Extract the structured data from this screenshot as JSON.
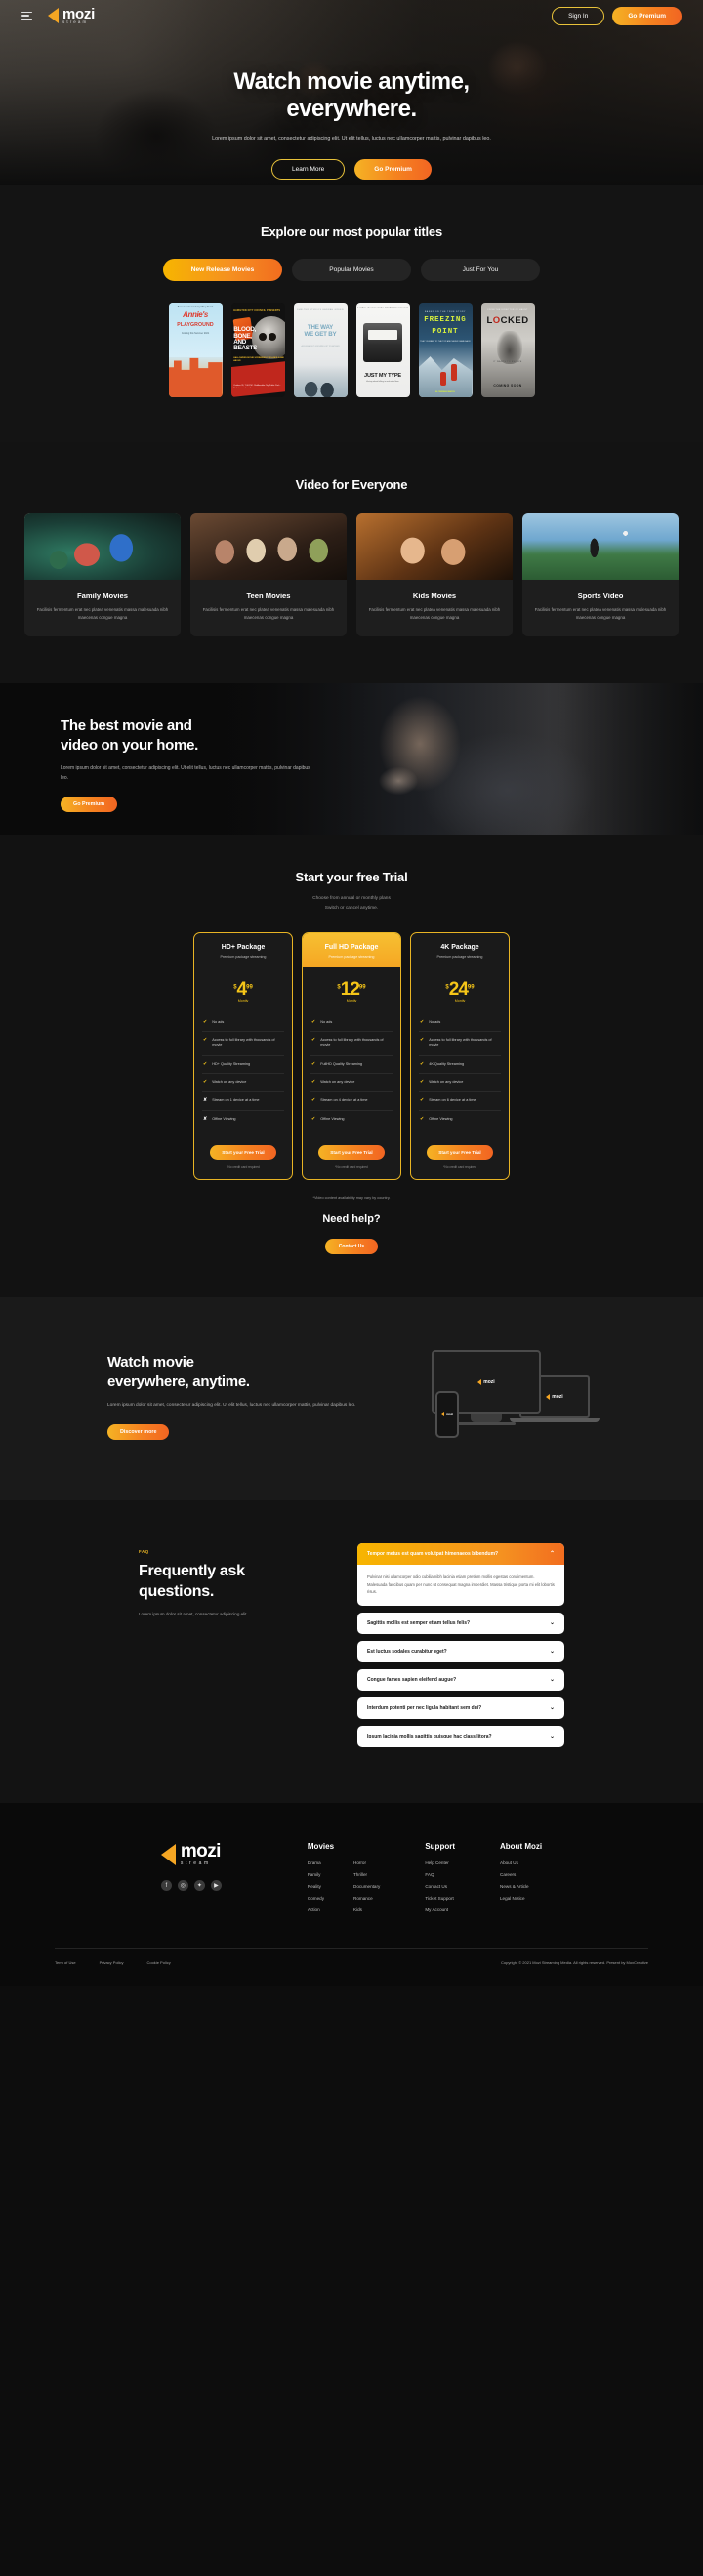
{
  "header": {
    "menu_icon": "hamburger-icon",
    "logo_word": "mozi",
    "logo_sub": "stream",
    "sign_in": "Sign In",
    "go_premium": "Go Premium"
  },
  "hero": {
    "title_line1": "Watch movie anytime,",
    "title_line2": "everywhere.",
    "desc": "Lorem ipsum dolor sit amet, consectetur adipiscing elit. Ut elit tellus, luctus nec ullamcorper mattis, pulvinar dapibus leo.",
    "learn_more": "Learn More",
    "go_premium": "Go Premium"
  },
  "explore": {
    "title": "Explore our most popular titles",
    "tabs": [
      {
        "label": "New Release Movies",
        "active": true
      },
      {
        "label": "Popular Movies",
        "active": false
      },
      {
        "label": "Just For You",
        "active": false
      }
    ],
    "posters": [
      {
        "title": "Annie's Playground",
        "line1": "Annie's",
        "line2": "PLAYGROUND",
        "credit": "Based on the book by Miley Stuart",
        "sub": "Coming this Summer 2021"
      },
      {
        "title": "Blood, Bone, and Beasts",
        "tag": "HAMILTON CITY COUNCIL PRESENTS",
        "line1": "BLOOD,",
        "line2": "BONE,",
        "line3": "AND",
        "line4": "BEASTS",
        "sub": "HALLOWEEN MOVIE SCREENING FOR AGES 6 AND ABOVE",
        "foot": "October 31, 7:30 PM  ·  Riddlesdale City Public Park  ·  Tickets on sale online"
      },
      {
        "title": "The Way We Get By",
        "credit": "SHELTER STUDIOS          HANNAH GREEN",
        "line1": "THE WAY",
        "line2": "WE GET BY",
        "sub": "A FILM ABOUT GROWING UP TOGETHER"
      },
      {
        "title": "Just My Type",
        "credit": "STUART MCGILLIVRAY            SARAH McCULLOCH",
        "line1": "JUST MY TYPE",
        "sub": "A story about falling in and out of love"
      },
      {
        "title": "Freezing Point",
        "credit": "BASED ON THE TRUE STORY",
        "line1": "FREEZING",
        "line2": "POINT",
        "sub": "THEY CLIMBED TO THE TOP AND NEVER CAME BACK",
        "foot": "IN CINEMAS MARCH"
      },
      {
        "title": "Locked",
        "top": "FROM THE DIRECTOR OF HAUNT",
        "line1": "LOCKED",
        "sub": "IT WANTS TO ESCAPE",
        "coming": "COMING SOON"
      }
    ]
  },
  "everyone": {
    "title": "Video for Everyone",
    "cards": [
      {
        "title": "Family Movies",
        "desc": "Facilisis fermentum erat nec platea venenatis massa malesuada nibh maecenas congue magna"
      },
      {
        "title": "Teen Movies",
        "desc": "Facilisis fermentum erat nec platea venenatis massa malesuada nibh maecenas congue magna"
      },
      {
        "title": "Kids Movies",
        "desc": "Facilisis fermentum erat nec platea venenatis massa malesuada nibh maecenas congue magna"
      },
      {
        "title": "Sports Video",
        "desc": "Facilisis fermentum erat nec platea venenatis massa malesuada nibh maecenas congue magna"
      }
    ]
  },
  "banner": {
    "title_line1": "The best movie and",
    "title_line2": "video on your home.",
    "desc": "Lorem ipsum dolor sit amet, consectetur adipiscing elit. Ut elit tellus, luctus nec ullamcorper mattis, pulvinar dapibus leo.",
    "cta": "Go Premium"
  },
  "pricing": {
    "title": "Start your free Trial",
    "sub_line1": "Choose from annual or monthly plans",
    "sub_line2": "Switch or cancel anytime.",
    "plans": [
      {
        "name": "HD+ Package",
        "tag": "Premium package streaming",
        "currency": "$",
        "price": "4",
        "decimals": "99",
        "period": "Montly",
        "featured": false,
        "features": [
          {
            "label": "No ads",
            "included": true
          },
          {
            "label": "Access to full library with thousands of movie",
            "included": true
          },
          {
            "label": "HD+ Quality Streaming",
            "included": true
          },
          {
            "label": "Watch on any device",
            "included": true
          },
          {
            "label": "Stream on 1 device at a time",
            "included": false
          },
          {
            "label": "Offine Viewing",
            "included": false
          }
        ],
        "cta": "Start your Free Trial",
        "note": "*No credit card required"
      },
      {
        "name": "Full HD Package",
        "tag": "Premium package streaming",
        "currency": "$",
        "price": "12",
        "decimals": "99",
        "period": "Montly",
        "featured": true,
        "features": [
          {
            "label": "No ads",
            "included": true
          },
          {
            "label": "Access to full library with thousands of movie",
            "included": true
          },
          {
            "label": "FullHD Quality Streaming",
            "included": true
          },
          {
            "label": "Watch on any device",
            "included": true
          },
          {
            "label": "Stream on 4 device at a time",
            "included": true
          },
          {
            "label": "Offine Viewing",
            "included": true
          }
        ],
        "cta": "Start your Free Trial",
        "note": "*No credit card required"
      },
      {
        "name": "4K Package",
        "tag": "Premium package streaming",
        "currency": "$",
        "price": "24",
        "decimals": "99",
        "period": "Montly",
        "featured": false,
        "features": [
          {
            "label": "No ads",
            "included": true
          },
          {
            "label": "Access to full library with thousands of movie",
            "included": true
          },
          {
            "label": "4K Quality Streaming",
            "included": true
          },
          {
            "label": "Watch on any device",
            "included": true
          },
          {
            "label": "Stream on 6 device at a time",
            "included": true
          },
          {
            "label": "Offine Viewing",
            "included": true
          }
        ],
        "cta": "Start your Free Trial",
        "note": "*No credit card required"
      }
    ],
    "availability_note": "*Video content availability may vary by country.",
    "need_help": "Need help?",
    "contact_cta": "Contact Us"
  },
  "devices": {
    "title_line1": "Watch movie",
    "title_line2": "everywhere, anytime.",
    "desc": "Lorem ipsum dolor sit amet, consectetur adipiscing elit. Ut elit tellus, luctus nec ullamcorper mattis, pulvinar dapibus leo.",
    "cta": "Discover more"
  },
  "faq": {
    "kicker": "FAQ",
    "title_line1": "Frequently ask",
    "title_line2": "questions.",
    "desc": "Lorem ipsum dolor sit amet, consectetur adipiscing elit.",
    "items": [
      {
        "q": "Tempor metus est quam volutpat himenaeos bibendum?",
        "a": "Pulvinar nisi ullamcorper odio cubilia nibh lacinia etiam pretium mollis egestas condimentum. Malesuada faucibus quam per nunc ut consequat magna imperdiet. Massa tristique porta mi elit lobortis risus.",
        "open": true
      },
      {
        "q": "Sagittis mollis est semper etiam tellus felis?",
        "a": "",
        "open": false
      },
      {
        "q": "Est luctus sodales curabitur eget?",
        "a": "",
        "open": false
      },
      {
        "q": "Congue fames sapien eleifend augue?",
        "a": "",
        "open": false
      },
      {
        "q": "Interdum potenti per nec ligula habitant sem dui?",
        "a": "",
        "open": false
      },
      {
        "q": "Ipsum lacinia mollis sagittis quisque hac class litora?",
        "a": "",
        "open": false
      }
    ]
  },
  "footer": {
    "logo_word": "mozi",
    "logo_sub": "stream",
    "socials": [
      "facebook-icon",
      "instagram-icon",
      "twitter-icon",
      "youtube-icon"
    ],
    "columns": [
      {
        "title": "Movies",
        "groups": [
          [
            "Drama",
            "Family",
            "Reality",
            "Comedy",
            "Action"
          ],
          [
            "Horror",
            "Thriller",
            "Documentary",
            "Romance",
            "Kids"
          ]
        ]
      },
      {
        "title": "Support",
        "groups": [
          [
            "Help Center",
            "FAQ",
            "Contact Us",
            "Ticket Support",
            "My Account"
          ]
        ]
      },
      {
        "title": "About Mozi",
        "groups": [
          [
            "About Us",
            "Careers",
            "News & Article",
            "Legal Notice"
          ]
        ]
      }
    ],
    "legal": [
      "Term of Use",
      "Privacy Policy",
      "Cookie Policy"
    ],
    "copyright": "Copyright © 2021 Mozi Streaming Media. All rights reserved. Present by MoxCreative"
  },
  "colors": {
    "accent_orange": "#F5A623",
    "accent_gold": "#F5C518",
    "accent_deep": "#F26522",
    "bg": "#131313"
  }
}
